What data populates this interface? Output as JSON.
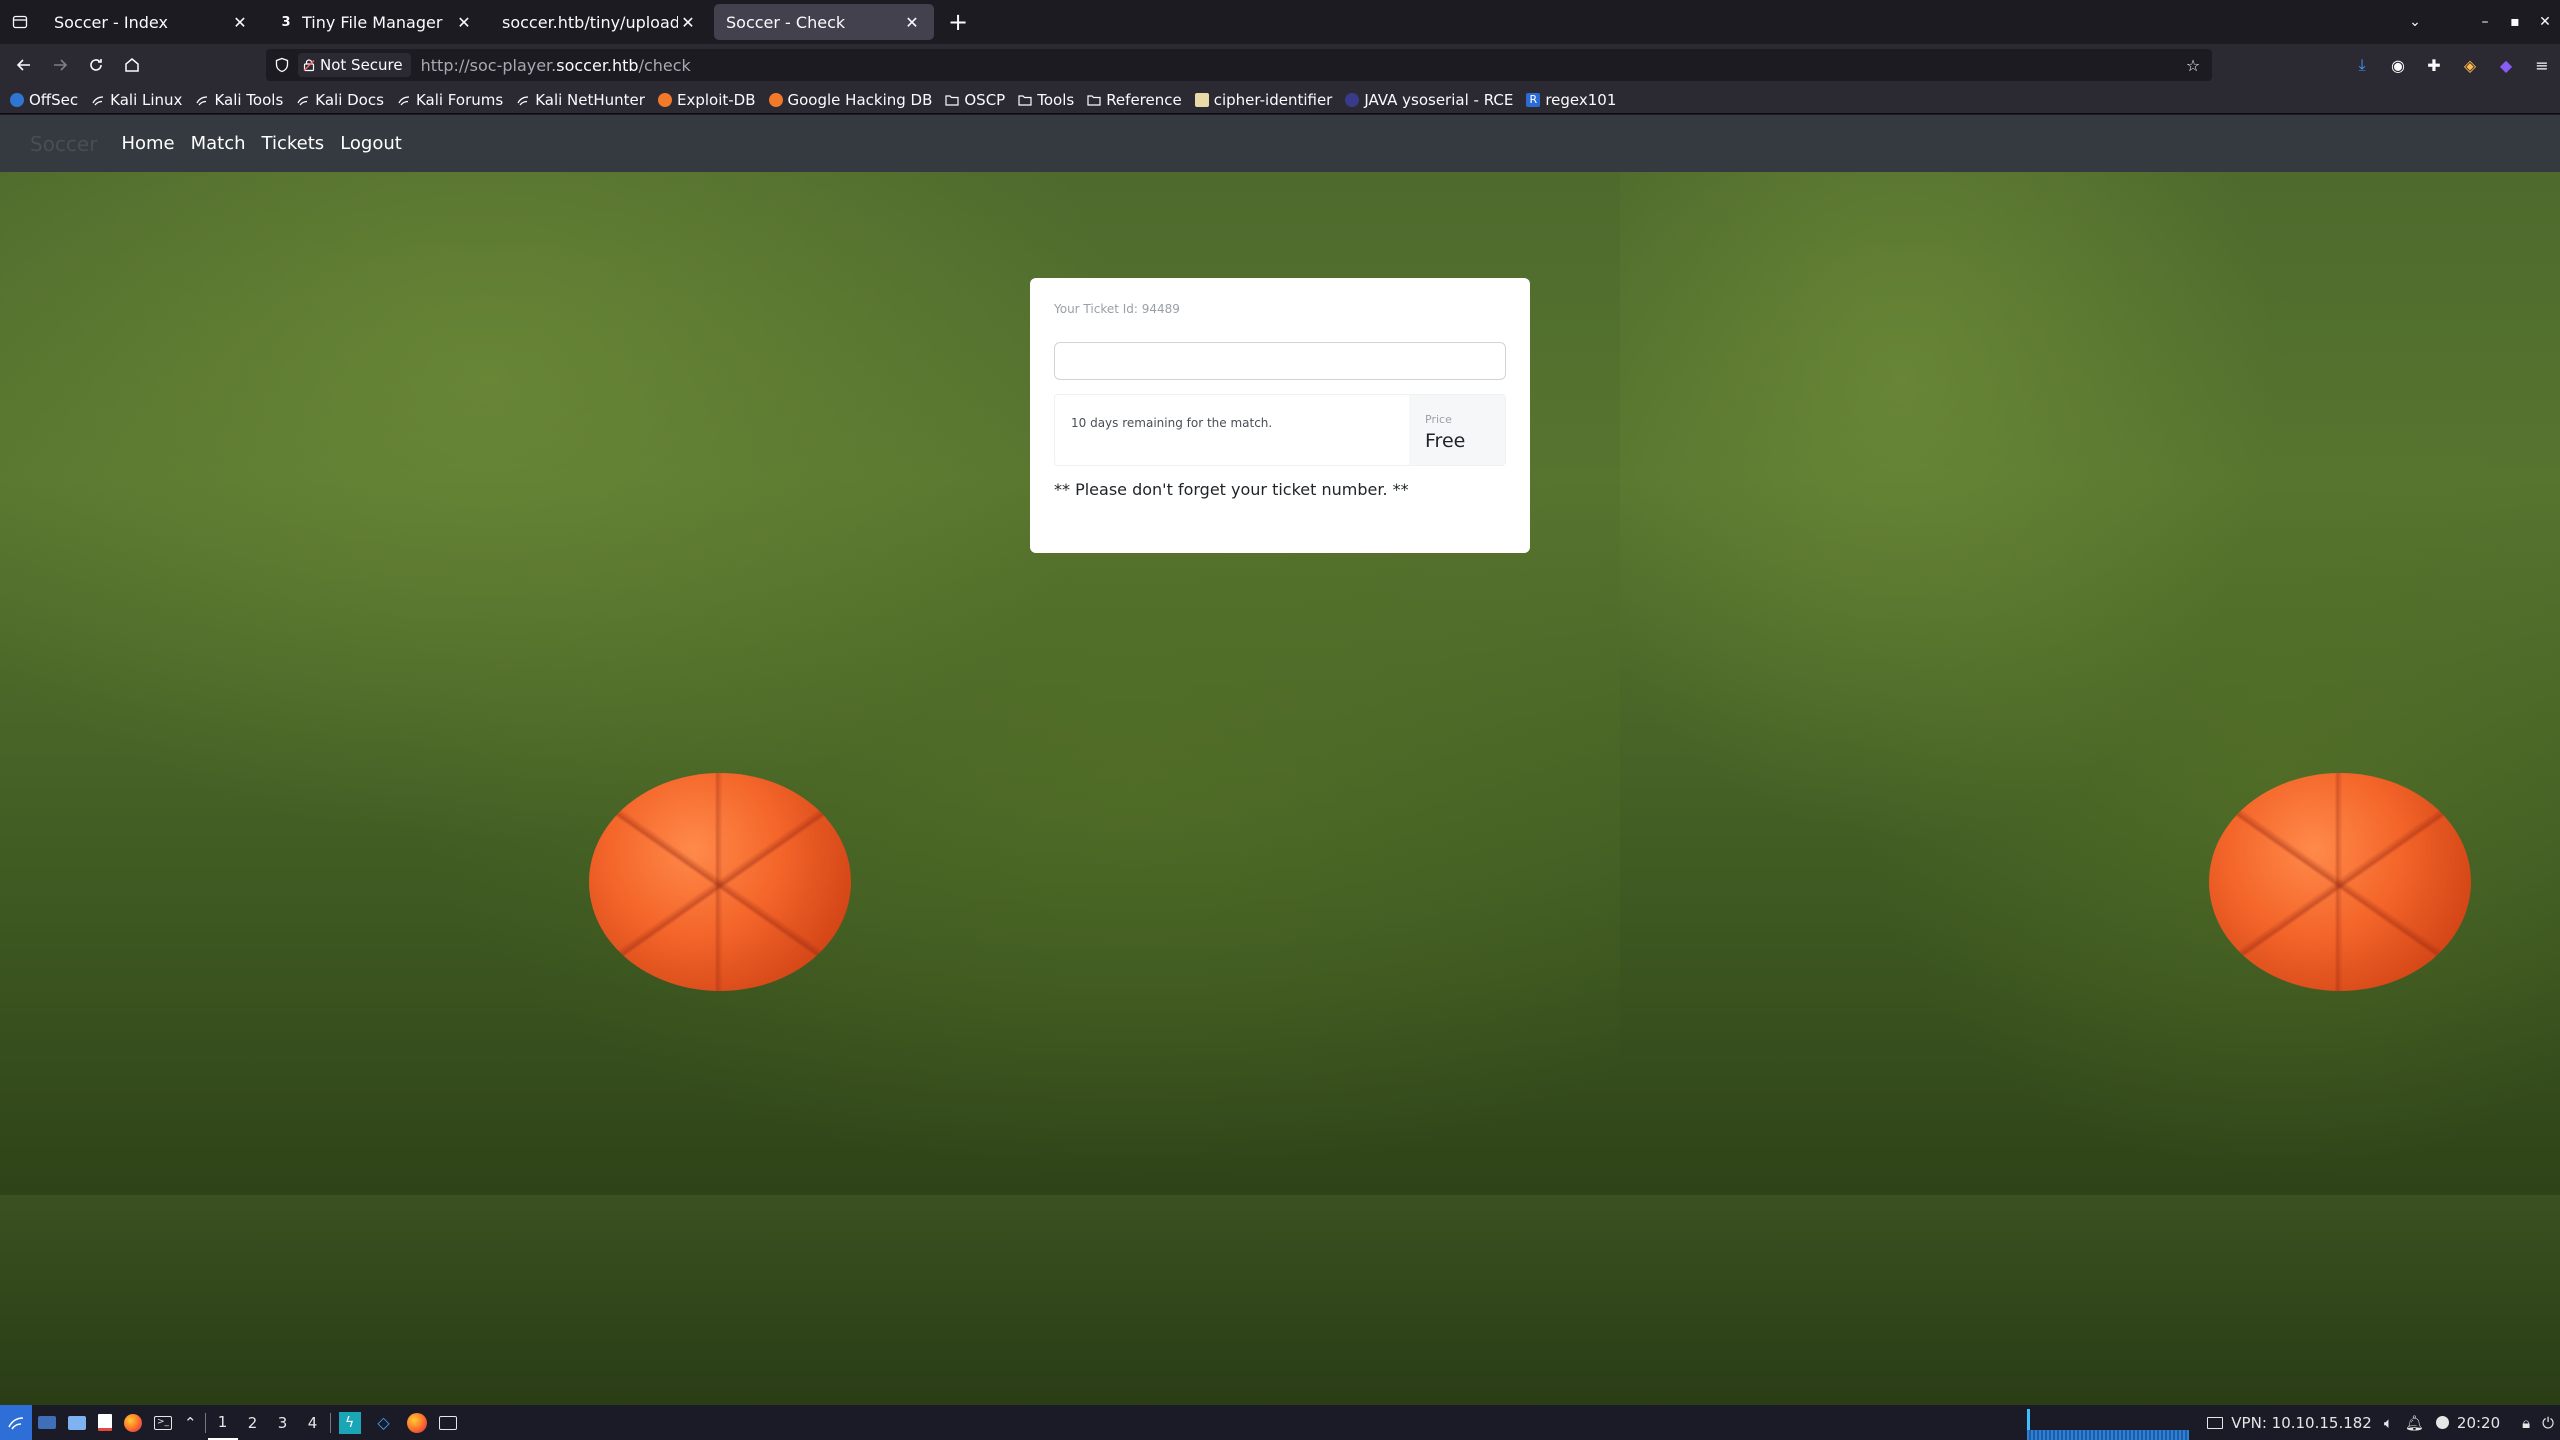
{
  "browser": {
    "tabs": [
      {
        "title": "Soccer - Index",
        "active": false,
        "icon": "globe-icon"
      },
      {
        "title": "Tiny File Manager",
        "active": false,
        "icon": "tfm-icon"
      },
      {
        "title": "soccer.htb/tiny/uploads/shell",
        "active": false,
        "icon": "page-icon"
      },
      {
        "title": "Soccer - Check",
        "active": true,
        "icon": "page-icon"
      }
    ],
    "security_label": "Not Secure",
    "url_prefix": "http://soc-player.",
    "url_host": "soccer.htb",
    "url_path": "/check"
  },
  "bookmarks": [
    {
      "label": "OffSec",
      "icon": "offsec-icon",
      "color": "#2f76d4"
    },
    {
      "label": "Kali Linux",
      "icon": "kali-icon",
      "color": "#ffffff"
    },
    {
      "label": "Kali Tools",
      "icon": "kali-icon",
      "color": "#ffffff"
    },
    {
      "label": "Kali Docs",
      "icon": "kali-icon",
      "color": "#ffffff"
    },
    {
      "label": "Kali Forums",
      "icon": "kali-icon",
      "color": "#ffffff"
    },
    {
      "label": "Kali NetHunter",
      "icon": "kali-icon",
      "color": "#ffffff"
    },
    {
      "label": "Exploit-DB",
      "icon": "exploitdb-icon",
      "color": "#f2792a"
    },
    {
      "label": "Google Hacking DB",
      "icon": "exploitdb-icon",
      "color": "#f2792a"
    },
    {
      "label": "OSCP",
      "icon": "folder-icon",
      "color": "#fbfbfe"
    },
    {
      "label": "Tools",
      "icon": "folder-icon",
      "color": "#fbfbfe"
    },
    {
      "label": "Reference",
      "icon": "folder-icon",
      "color": "#fbfbfe"
    },
    {
      "label": "cipher-identifier",
      "icon": "dcode-icon",
      "color": "#e8d9a8"
    },
    {
      "label": "JAVA ysoserial - RCE",
      "icon": "java-icon",
      "color": "#3a3a8a"
    },
    {
      "label": "regex101",
      "icon": "regex-icon",
      "color": "#2b6bd6"
    }
  ],
  "site": {
    "brand": "Soccer",
    "nav": [
      "Home",
      "Match",
      "Tickets",
      "Logout"
    ]
  },
  "ticket": {
    "id_label": "Your Ticket Id: 94489",
    "input_value": "",
    "days_text": "10 days remaining for the match.",
    "price_label": "Price",
    "price_value": "Free",
    "note": "** Please don't forget your ticket number. **"
  },
  "taskbar": {
    "workspaces": [
      "1",
      "2",
      "3",
      "4"
    ],
    "active_workspace": "1",
    "vpn_text": "VPN: 10.10.15.182",
    "clock": "20:20"
  },
  "colors": {
    "site_nav_bg": "#343a40",
    "card_bg": "#ffffff",
    "ball": "#f4662a"
  }
}
